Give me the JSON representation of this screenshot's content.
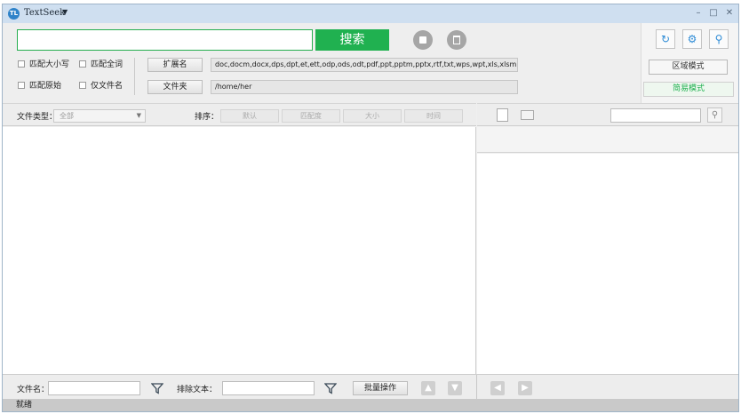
{
  "app": {
    "icon_text": "TL",
    "title": "TextSeek",
    "title_menu_icon": "caret-down-icon"
  },
  "window_controls": {
    "minimize": "–",
    "maximize": "□",
    "close": "✕"
  },
  "search": {
    "query": "",
    "button_label": "搜索"
  },
  "options": {
    "match_case": "匹配大小写",
    "match_whole_word": "匹配全词",
    "match_original": "匹配原始",
    "filename_only": "仅文件名"
  },
  "extension": {
    "button_label": "扩展名",
    "value": "doc,docm,docx,dps,dpt,et,ett,odp,ods,odt,pdf,ppt,pptm,pptx,rtf,txt,wps,wpt,xls,xlsm,xlsx"
  },
  "folder": {
    "button_label": "文件夹",
    "value": "/home/her"
  },
  "mode": {
    "region_mode": "区域模式",
    "simple_mode": "简易模式"
  },
  "filter_bar": {
    "file_type_label": "文件类型：",
    "file_type_value": "全部",
    "sort_label": "排序：",
    "sort_options": [
      "默认",
      "匹配度",
      "大小",
      "时间"
    ]
  },
  "bottom": {
    "filename_label": "文件名：",
    "exclude_text_label": "排除文本：",
    "batch_label": "批量操作"
  },
  "status": {
    "text": "就绪"
  },
  "colors": {
    "accent": "#20b150",
    "titlebar": "#cfdff0",
    "tool_icon": "#2d8bd6"
  }
}
